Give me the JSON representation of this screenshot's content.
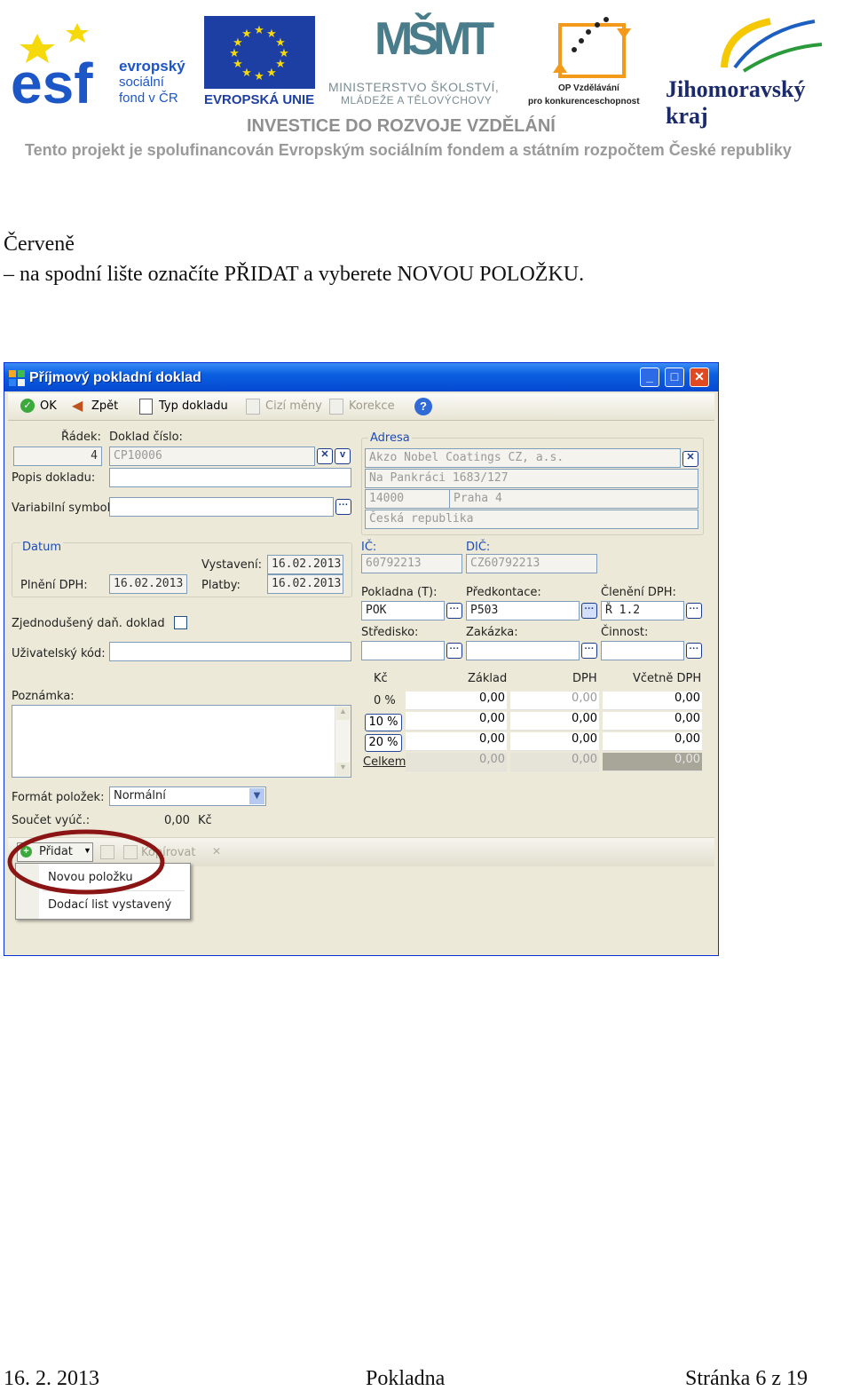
{
  "header": {
    "esf_line1": "evropský",
    "esf_line2": "sociální",
    "esf_line3": "fond v ČR",
    "eu_label": "EVROPSKÁ UNIE",
    "msmt_logo": "MŠMT",
    "msmt_line1": "MINISTERSTVO ŠKOLSTVÍ,",
    "msmt_line2": "MLÁDEŽE A TĚLOVÝCHOVY",
    "op_line1": "OP Vzdělávání",
    "op_line2": "pro konkurenceschopnost",
    "kraj": "Jihomoravský kraj",
    "investice": "INVESTICE DO ROZVOJE VZDĚLÁNÍ",
    "financing": "Tento projekt je spolufinancován Evropským sociálním fondem a státním rozpočtem České republiky"
  },
  "body": {
    "line1": "Červeně",
    "line2": "– na spodní lište označíte PŘIDAT a vyberete NOVOU POLOŽKU."
  },
  "window": {
    "title": "Příjmový pokladní doklad",
    "toolbar": {
      "ok": "OK",
      "back": "Zpět",
      "doc_type": "Typ dokladu",
      "foreign": "Cizí měny",
      "correction": "Korekce"
    },
    "form": {
      "radek_label": "Řádek:",
      "radek_value": "4",
      "doklad_label": "Doklad číslo:",
      "doklad_value": "CP10006",
      "popis_label": "Popis dokladu:",
      "variabilni_label": "Variabilní symbol:",
      "datum_label": "Datum",
      "vystaveni_label": "Vystavení:",
      "vystaveni_value": "16.02.2013",
      "plneni_label": "Plnění DPH:",
      "plneni_value": "16.02.2013",
      "platby_label": "Platby:",
      "platby_value": "16.02.2013",
      "zjednoduseny_label": "Zjednodušený daň. doklad",
      "uzivatelsky_label": "Uživatelský kód:",
      "poznamka_label": "Poznámka:",
      "format_label": "Formát položek:",
      "format_value": "Normální",
      "soucet_label": "Součet vyúč.:",
      "soucet_value": "0,00",
      "soucet_currency": "Kč"
    },
    "address": {
      "label": "Adresa",
      "name": "Akzo Nobel Coatings CZ, a.s.",
      "street": "Na Pankráci 1683/127",
      "zip": "14000",
      "city": "Praha 4",
      "country": "Česká republika"
    },
    "ids": {
      "ic_label": "IČ:",
      "ic_value": "60792213",
      "dic_label": "DIČ:",
      "dic_value": "CZ60792213"
    },
    "pokladna": {
      "pokladna_label": "Pokladna (T):",
      "pokladna_value": "POK",
      "predkontace_label": "Předkontace:",
      "predkontace_value": "P503",
      "cleneni_label": "Členění DPH:",
      "cleneni_value": "Ř 1.2",
      "stredisko_label": "Středisko:",
      "zakazka_label": "Zakázka:",
      "cinnost_label": "Činnost:"
    },
    "vat_table": {
      "headers": [
        "Kč",
        "Základ",
        "DPH",
        "Včetně DPH"
      ],
      "rows": [
        {
          "rate": "0 %",
          "zaklad": "0,00",
          "dph": "0,00",
          "vcetne": "0,00"
        },
        {
          "rate": "10 %",
          "zaklad": "0,00",
          "dph": "0,00",
          "vcetne": "0,00"
        },
        {
          "rate": "20 %",
          "zaklad": "0,00",
          "dph": "0,00",
          "vcetne": "0,00"
        },
        {
          "rate": "Celkem",
          "zaklad": "0,00",
          "dph": "0,00",
          "vcetne": "0,00"
        }
      ]
    },
    "bottom_bar": {
      "pridat": "Přidat",
      "kopirovat": "Kopírovat"
    },
    "menu": {
      "item1": "Novou položku",
      "item2": "Dodací list vystavený"
    }
  },
  "footer": {
    "date": "16. 2. 2013",
    "center": "Pokladna",
    "page": "Stránka 6 z 19"
  }
}
